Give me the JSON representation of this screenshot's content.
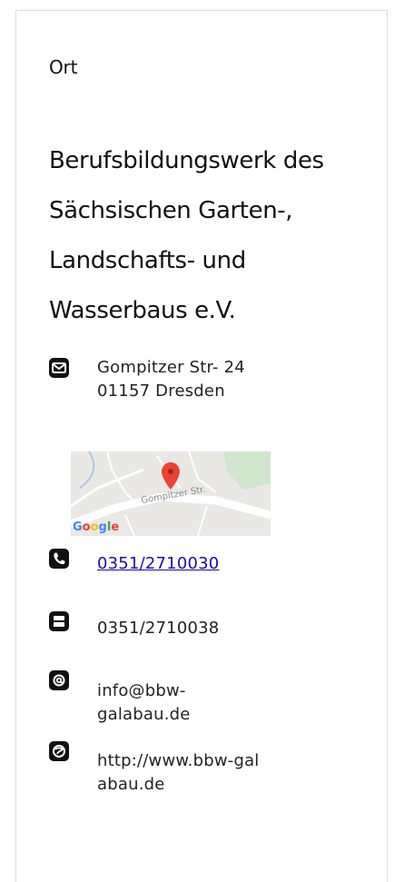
{
  "section_label": "Ort",
  "organization": {
    "lines": [
      "Berufsbildungswerk des",
      "Sächsischen Garten-,",
      "Landschafts- und",
      "Wasserbaus e.V."
    ]
  },
  "address": {
    "icon": "mail-envelope-icon",
    "street": "Gompitzer Str- 24",
    "city": "01157 Dresden"
  },
  "map": {
    "street_label": "Gompitzer Str.",
    "provider": "Google"
  },
  "phone": {
    "icon": "phone-icon",
    "value": "0351/2710030"
  },
  "fax": {
    "icon": "fax-icon",
    "value": "0351/2710038"
  },
  "email": {
    "icon": "at-sign-icon",
    "line1": "info@bbw-",
    "line2": "galabau.de"
  },
  "website": {
    "icon": "globe-icon",
    "line1": "http://www.bbw-gal",
    "line2": "abau.de"
  },
  "colors": {
    "link": "#1a0dab",
    "border": "#dcdcdc",
    "map_pin": "#ea4335"
  }
}
